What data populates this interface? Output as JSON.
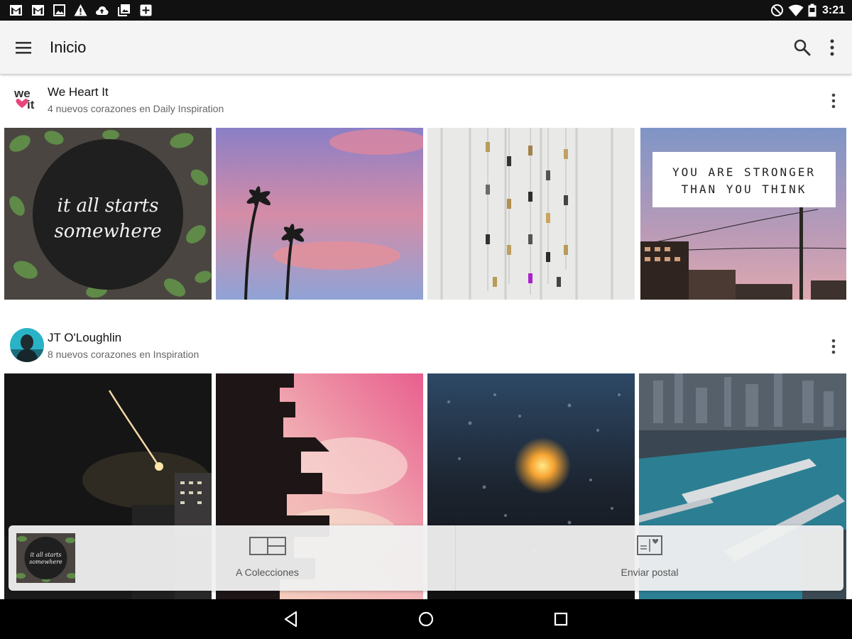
{
  "status_bar": {
    "time": "3:21",
    "left_icons": [
      "gmail-icon",
      "gmail-icon",
      "image-icon",
      "warning-icon",
      "cloud-upload-icon",
      "multi-image-icon",
      "add-box-icon"
    ],
    "right_icons": [
      "do-not-disturb-icon",
      "wifi-icon",
      "battery-icon"
    ]
  },
  "app_bar": {
    "title": "Inicio",
    "icons": [
      "menu-icon",
      "search-icon",
      "more-vert-icon"
    ]
  },
  "feed": [
    {
      "name": "We Heart It",
      "subtitle": "4 nuevos corazones en Daily Inspiration",
      "avatar": "we-heart-it-logo",
      "avatar_text": "we it",
      "images": [
        {
          "subject": "plants-circle-quote",
          "caption": "it all starts somewhere"
        },
        {
          "subject": "palm-trees-sunset",
          "caption": ""
        },
        {
          "subject": "hanging-keys",
          "caption": ""
        },
        {
          "subject": "quote-stronger",
          "caption": "YOU ARE STRONGER THAN YOU THINK"
        }
      ]
    },
    {
      "name": "JT O'Loughlin",
      "subtitle": "8 nuevos corazones en Inspiration",
      "avatar": "user-avatar",
      "images": [
        {
          "subject": "rocket-launch-night"
        },
        {
          "subject": "city-skyline-pink"
        },
        {
          "subject": "rainy-window-light"
        },
        {
          "subject": "aerial-city-harbor"
        }
      ]
    }
  ],
  "action_sheet": {
    "preview_caption": "it all starts somewhere",
    "actions": [
      {
        "label": "A Colecciones",
        "icon": "collections-icon"
      },
      {
        "label": "Enviar postal",
        "icon": "postcard-icon"
      }
    ]
  },
  "nav_bar": {
    "icons": [
      "back-icon",
      "home-icon",
      "recents-icon"
    ]
  },
  "colors": {
    "app_bar_bg": "#f4f4f4",
    "status_bar_bg": "#111111",
    "brand_pink": "#e8457c",
    "brand_dark": "#333333"
  }
}
